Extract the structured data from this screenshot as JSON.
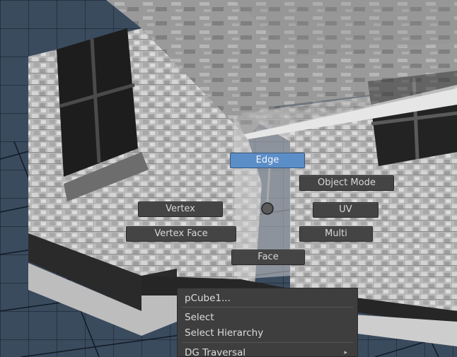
{
  "marking_menu": {
    "north": "Edge",
    "north_east": "Object Mode",
    "west": "Vertex",
    "east": "UV",
    "south_west": "Vertex Face",
    "south_east": "Multi",
    "south": "Face",
    "active_item": "Edge"
  },
  "context_menu": {
    "items": [
      {
        "label": "pCube1..."
      },
      {
        "label": "Select"
      },
      {
        "label": "Select Hierarchy"
      },
      {
        "label": "DG Traversal",
        "has_submenu": true
      }
    ]
  },
  "colors": {
    "button_bg": "#444444",
    "button_active_bg": "#5b8ec7",
    "menu_bg": "#3e3e3e",
    "viewport_grid": "#1e2a38"
  }
}
